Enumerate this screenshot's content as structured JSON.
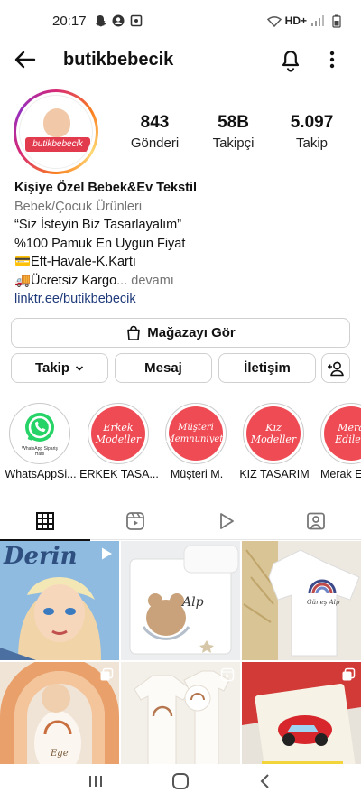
{
  "status_bar": {
    "time": "20:17",
    "network": "HD+"
  },
  "header": {
    "username": "butikbebecik"
  },
  "profile": {
    "avatar_brand_text": "butikbebecik",
    "stats": [
      {
        "value": "843",
        "label": "Gönderi"
      },
      {
        "value": "58B",
        "label": "Takipçi"
      },
      {
        "value": "5.097",
        "label": "Takip"
      }
    ]
  },
  "bio": {
    "name": "Kişiye Özel Bebek&Ev Tekstil",
    "category": "Bebek/Çocuk Ürünleri",
    "lines": [
      "“Siz İsteyin Biz Tasarlayalım”",
      "%100 Pamuk En Uygun Fiyat",
      "💳Eft-Havale-K.Kartı",
      "🚚Ücretsiz Kargo"
    ],
    "more": "... devamı",
    "link": "linktr.ee/butikbebecik"
  },
  "buttons": {
    "shop": "Mağazayı Gör",
    "follow": "Takip",
    "message": "Mesaj",
    "contact": "İletişim"
  },
  "highlights": [
    {
      "cover_text": "WhatsApp Sipariş Hattı",
      "label": "WhatsAppSi..."
    },
    {
      "cover_text": "Erkek Modeller",
      "label": "ERKEK TASA..."
    },
    {
      "cover_text": "Müşteri Memnuniyeti",
      "label": "Müşteri M."
    },
    {
      "cover_text": "Kız Modeller",
      "label": "KIZ TASARIM"
    },
    {
      "cover_text": "Mera Edilen",
      "label": "Merak Ed"
    }
  ],
  "grid_overlay_text": {
    "post1": "Derin",
    "post2": "Alp",
    "post3": "Güneş Alp",
    "post4": "Ege"
  },
  "colors": {
    "highlight_red": "#ef4b54",
    "link_blue": "#1f3a7a",
    "brand_red": "#e23b4e"
  }
}
